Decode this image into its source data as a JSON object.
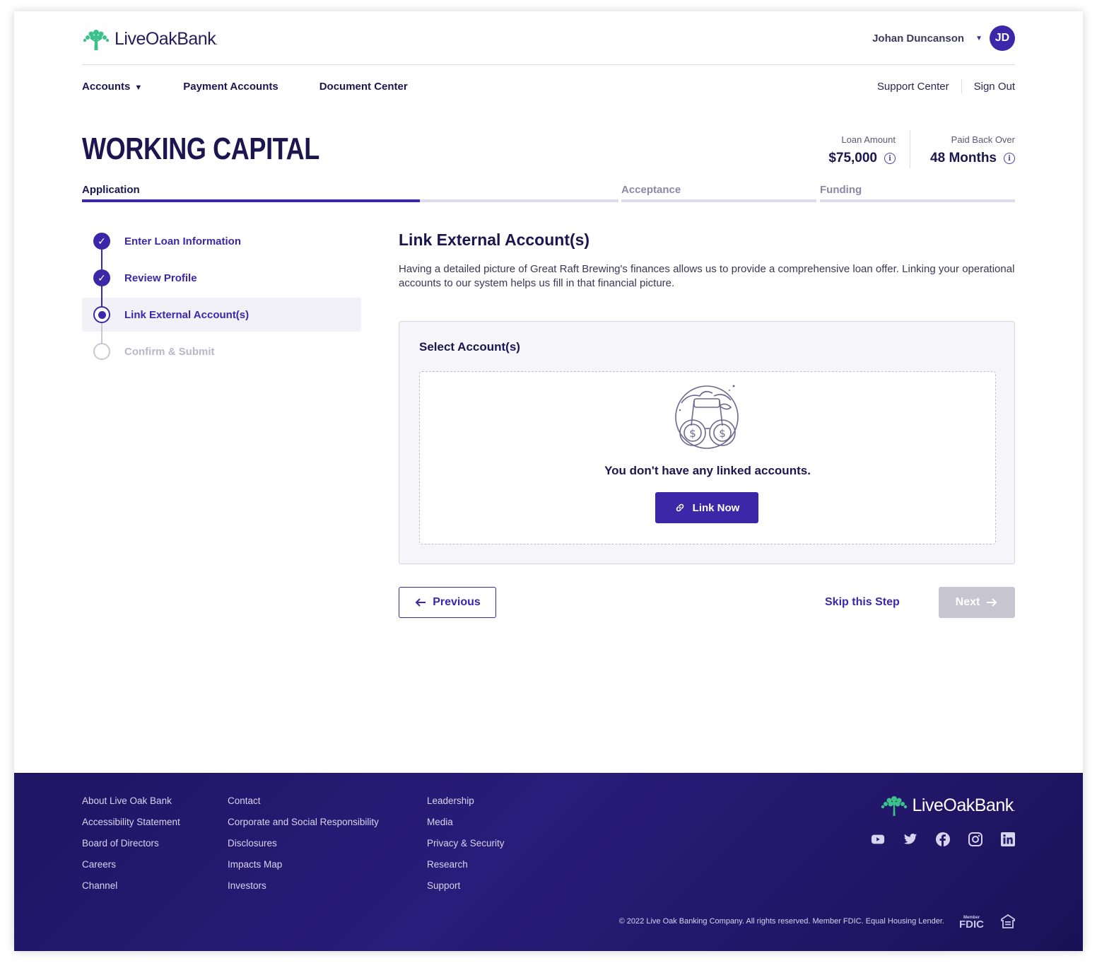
{
  "brand": {
    "name_live": "LiveOak",
    "name_bank": "Bank",
    "dot": "."
  },
  "user": {
    "name": "Johan Duncanson",
    "initials": "JD"
  },
  "nav": {
    "accounts": "Accounts",
    "payment_accounts": "Payment Accounts",
    "document_center": "Document Center",
    "support_center": "Support Center",
    "sign_out": "Sign Out"
  },
  "page": {
    "title": "WORKING CAPITAL",
    "loan_amount_label": "Loan Amount",
    "loan_amount_value": "$75,000",
    "paid_back_label": "Paid Back Over",
    "paid_back_value": "48 Months"
  },
  "phases": [
    {
      "label": "Application",
      "progress": 0.63
    },
    {
      "label": "Acceptance",
      "progress": 0
    },
    {
      "label": "Funding",
      "progress": 0
    }
  ],
  "steps": [
    {
      "label": "Enter Loan Information",
      "state": "done"
    },
    {
      "label": "Review Profile",
      "state": "done"
    },
    {
      "label": "Link External Account(s)",
      "state": "current"
    },
    {
      "label": "Confirm & Submit",
      "state": "todo"
    }
  ],
  "main": {
    "heading": "Link External Account(s)",
    "description": "Having a detailed picture of Great Raft Brewing's finances allows us to provide a comprehensive loan offer. Linking your operational accounts to our system helps us fill in that financial picture.",
    "card_title": "Select Account(s)",
    "empty_message": "You don't have any linked accounts.",
    "link_button": "Link Now",
    "previous_button": "Previous",
    "skip_link": "Skip this Step",
    "next_button": "Next"
  },
  "footer": {
    "col1": [
      "About Live Oak Bank",
      "Accessibility Statement",
      "Board of Directors",
      "Careers",
      "Channel"
    ],
    "col2": [
      "Contact",
      "Corporate and Social Responsibility",
      "Disclosures",
      "Impacts Map",
      "Investors"
    ],
    "col3": [
      "Leadership",
      "Media",
      "Privacy & Security",
      "Research",
      "Support"
    ],
    "social_icons": [
      "youtube-icon",
      "twitter-icon",
      "facebook-icon",
      "instagram-icon",
      "linkedin-icon"
    ],
    "copyright": "© 2022 Live Oak Banking Company. All rights reserved. Member FDIC. Equal Housing Lender.",
    "fdic_member": "Member",
    "fdic": "FDIC"
  },
  "colors": {
    "primary": "#3b27a8",
    "brand_green": "#3dc18a",
    "footer_bg": "#1e1563",
    "disabled": "#c7c6d0"
  }
}
